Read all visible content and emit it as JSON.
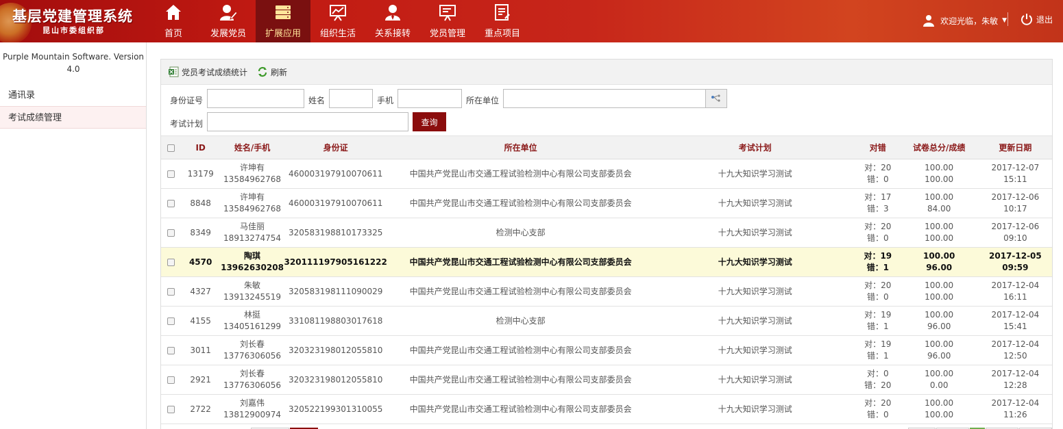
{
  "app": {
    "title": "基层党建管理系统",
    "subtitle": "昆山市委组织部"
  },
  "nav": [
    {
      "label": "首页",
      "icon": "home-icon",
      "active": false
    },
    {
      "label": "发展党员",
      "icon": "user-edit-icon",
      "active": false
    },
    {
      "label": "扩展应用",
      "icon": "database-icon",
      "active": true
    },
    {
      "label": "组织生活",
      "icon": "presentation-chart-icon",
      "active": false
    },
    {
      "label": "关系接转",
      "icon": "user-tie-icon",
      "active": false
    },
    {
      "label": "党员管理",
      "icon": "edit-board-icon",
      "active": false
    },
    {
      "label": "重点项目",
      "icon": "document-list-icon",
      "active": false
    }
  ],
  "user": {
    "greeting": "欢迎光临，朱敏",
    "logout": "退出"
  },
  "sidebar": {
    "version": "Purple Mountain Software. Version 4.0",
    "items": [
      {
        "label": "通讯录"
      },
      {
        "label": "考试成绩管理"
      }
    ]
  },
  "toolbar": {
    "stats": "党员考试成绩统计",
    "refresh": "刷新"
  },
  "filters": {
    "idcard": "身份证号",
    "name": "姓名",
    "phone": "手机",
    "unit": "所在单位",
    "plan": "考试计划",
    "search": "查询"
  },
  "table": {
    "headers": [
      "ID",
      "姓名/手机",
      "身份证",
      "所在单位",
      "考试计划",
      "对错",
      "试卷总分/成绩",
      "更新日期"
    ],
    "rows": [
      {
        "id": "13179",
        "name": "许坤有",
        "phone": "13584962768",
        "idcard": "460003197910070611",
        "unit": "中国共产党昆山市交通工程试验检测中心有限公司支部委员会",
        "plan": "十九大知识学习测试",
        "ok": "对：20",
        "err": "错：0",
        "total": "100.00",
        "score": "100.00",
        "date": "2017-12-07",
        "time": "15:11",
        "hl": false
      },
      {
        "id": "8848",
        "name": "许坤有",
        "phone": "13584962768",
        "idcard": "460003197910070611",
        "unit": "中国共产党昆山市交通工程试验检测中心有限公司支部委员会",
        "plan": "十九大知识学习测试",
        "ok": "对：17",
        "err": "错：3",
        "total": "100.00",
        "score": "84.00",
        "date": "2017-12-06",
        "time": "10:17",
        "hl": false
      },
      {
        "id": "8349",
        "name": "马佳丽",
        "phone": "18913274754",
        "idcard": "320583198810173325",
        "unit": "检测中心支部",
        "plan": "十九大知识学习测试",
        "ok": "对：20",
        "err": "错：0",
        "total": "100.00",
        "score": "100.00",
        "date": "2017-12-06",
        "time": "09:10",
        "hl": false
      },
      {
        "id": "4570",
        "name": "陶琪",
        "phone": "13962630208",
        "idcard": "320111197905161222",
        "unit": "中国共产党昆山市交通工程试验检测中心有限公司支部委员会",
        "plan": "十九大知识学习测试",
        "ok": "对：19",
        "err": "错：1",
        "total": "100.00",
        "score": "96.00",
        "date": "2017-12-05",
        "time": "09:59",
        "hl": true
      },
      {
        "id": "4327",
        "name": "朱敏",
        "phone": "13913245519",
        "idcard": "320583198111090029",
        "unit": "中国共产党昆山市交通工程试验检测中心有限公司支部委员会",
        "plan": "十九大知识学习测试",
        "ok": "对：20",
        "err": "错：0",
        "total": "100.00",
        "score": "100.00",
        "date": "2017-12-04",
        "time": "16:11",
        "hl": false
      },
      {
        "id": "4155",
        "name": "林挺",
        "phone": "13405161299",
        "idcard": "331081198803017618",
        "unit": "检测中心支部",
        "plan": "十九大知识学习测试",
        "ok": "对：19",
        "err": "错：1",
        "total": "100.00",
        "score": "96.00",
        "date": "2017-12-04",
        "time": "15:41",
        "hl": false
      },
      {
        "id": "3011",
        "name": "刘长春",
        "phone": "13776306056",
        "idcard": "320323198012055810",
        "unit": "中国共产党昆山市交通工程试验检测中心有限公司支部委员会",
        "plan": "十九大知识学习测试",
        "ok": "对：19",
        "err": "错：1",
        "total": "100.00",
        "score": "96.00",
        "date": "2017-12-04",
        "time": "12:50",
        "hl": false
      },
      {
        "id": "2921",
        "name": "刘长春",
        "phone": "13776306056",
        "idcard": "320323198012055810",
        "unit": "中国共产党昆山市交通工程试验检测中心有限公司支部委员会",
        "plan": "十九大知识学习测试",
        "ok": "对：0",
        "err": "错：20",
        "total": "100.00",
        "score": "0.00",
        "date": "2017-12-04",
        "time": "12:28",
        "hl": false
      },
      {
        "id": "2722",
        "name": "刘嘉伟",
        "phone": "13812900974",
        "idcard": "320522199301310055",
        "unit": "中国共产党昆山市交通工程试验检测中心有限公司支部委员会",
        "plan": "十九大知识学习测试",
        "ok": "对：20",
        "err": "错：0",
        "total": "100.00",
        "score": "100.00",
        "date": "2017-12-04",
        "time": "11:26",
        "hl": false
      }
    ]
  }
}
